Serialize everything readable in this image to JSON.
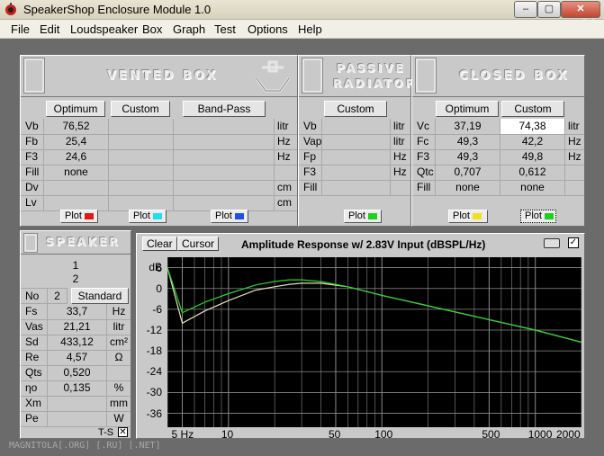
{
  "window": {
    "title": "SpeakerShop Enclosure Module 1.0",
    "watermark": "MAGNITOLA",
    "bottom_watermark": "MAGNITOLA[.ORG] [.RU] [.NET]"
  },
  "menu": [
    "File",
    "Edit",
    "Loudspeaker",
    "Box",
    "Graph",
    "Test",
    "Options",
    "Help"
  ],
  "vented": {
    "title": "VENTED BOX",
    "buttons": [
      "Optimum",
      "Custom",
      "Band-Pass"
    ],
    "rows": [
      {
        "label": "Vb",
        "values": [
          "76,52",
          "",
          ""
        ],
        "unit": "litr"
      },
      {
        "label": "Fb",
        "values": [
          "25,4",
          "",
          ""
        ],
        "unit": "Hz"
      },
      {
        "label": "F3",
        "values": [
          "24,6",
          "",
          ""
        ],
        "unit": "Hz"
      },
      {
        "label": "Fill",
        "values": [
          "none",
          "",
          ""
        ],
        "unit": ""
      },
      {
        "label": "Dv",
        "values": [
          "",
          "",
          ""
        ],
        "unit": "cm"
      },
      {
        "label": "Lv",
        "values": [
          "",
          "",
          ""
        ],
        "unit": "cm"
      }
    ],
    "plot_label": "Plot",
    "plot_colors": [
      "#e01818",
      "#20e0f0",
      "#2050e0"
    ]
  },
  "passive": {
    "title_line1": "PASSIVE",
    "title_line2": "RADIATOR",
    "button": "Custom",
    "rows": [
      {
        "label": "Vb",
        "value": "",
        "unit": "litr"
      },
      {
        "label": "Vap",
        "value": "",
        "unit": "litr"
      },
      {
        "label": "Fp",
        "value": "",
        "unit": "Hz"
      },
      {
        "label": "F3",
        "value": "",
        "unit": "Hz"
      },
      {
        "label": "Fill",
        "value": "",
        "unit": ""
      }
    ],
    "plot_label": "Plot",
    "plot_color": "#20d020"
  },
  "closed": {
    "title": "CLOSED BOX",
    "buttons": [
      "Optimum",
      "Custom"
    ],
    "rows": [
      {
        "label": "Vc",
        "values": [
          "37,19",
          "74,38"
        ],
        "unit": "litr"
      },
      {
        "label": "Fc",
        "values": [
          "49,3",
          "42,2"
        ],
        "unit": "Hz"
      },
      {
        "label": "F3",
        "values": [
          "49,3",
          "49,8"
        ],
        "unit": "Hz"
      },
      {
        "label": "Qtc",
        "values": [
          "0,707",
          "0,612"
        ],
        "unit": ""
      },
      {
        "label": "Fill",
        "values": [
          "none",
          "none"
        ],
        "unit": ""
      }
    ],
    "plot_label": "Plot",
    "plot_colors": [
      "#f0e020",
      "#20d020"
    ]
  },
  "speaker": {
    "title": "SPEAKER",
    "line1": "1",
    "line2": "2",
    "no_label": "No",
    "no_value": "2",
    "standard": "Standard",
    "rows": [
      {
        "label": "Fs",
        "value": "33,7",
        "unit": "Hz"
      },
      {
        "label": "Vas",
        "value": "21,21",
        "unit": "litr"
      },
      {
        "label": "Sd",
        "value": "433,12",
        "unit": "cm²"
      },
      {
        "label": "Re",
        "value": "4,57",
        "unit": "Ω"
      },
      {
        "label": "Qts",
        "value": "0,520",
        "unit": ""
      },
      {
        "label": "ηo",
        "value": "0,135",
        "unit": "%"
      },
      {
        "label": "Xm",
        "value": "",
        "unit": "mm"
      },
      {
        "label": "Pe",
        "value": "",
        "unit": "W"
      }
    ],
    "ts_label": "T-S"
  },
  "graph": {
    "clear": "Clear",
    "cursor": "Cursor",
    "title": "Amplitude Response w/ 2.83V Input (dBSPL/Hz)",
    "unit": "dB",
    "y_ticks": [
      "6",
      "0",
      "-6",
      "-12",
      "-18",
      "-24",
      "-30",
      "-36"
    ],
    "x_ticks": [
      "5 Hz",
      "10",
      "50",
      "100",
      "500",
      "1000",
      "2000"
    ]
  },
  "chart_data": {
    "type": "line",
    "title": "Amplitude Response w/ 2.83V Input (dBSPL/Hz)",
    "xlabel": "Hz",
    "ylabel": "dB",
    "xscale": "log",
    "xlim": [
      4,
      2000
    ],
    "ylim": [
      -40,
      9
    ],
    "grid": true,
    "series": [
      {
        "color": "#e8e0c0",
        "x": [
          4,
          5,
          7,
          10,
          15,
          20,
          25,
          30,
          40,
          60,
          100,
          200,
          500,
          1000,
          2000
        ],
        "y": [
          6,
          -10,
          -6.5,
          -3.5,
          -0.5,
          0.5,
          1.2,
          1.5,
          1.5,
          0.5,
          -2,
          -5,
          -9,
          -12,
          -15.5
        ]
      },
      {
        "color": "#30d030",
        "x": [
          4,
          5,
          7,
          10,
          15,
          20,
          25,
          30,
          40,
          60,
          100,
          200,
          500,
          1000,
          2000
        ],
        "y": [
          6,
          -7,
          -4,
          -1.5,
          1,
          2,
          2.5,
          2.5,
          2,
          0.5,
          -2,
          -5,
          -9,
          -12,
          -15.5
        ]
      }
    ]
  }
}
